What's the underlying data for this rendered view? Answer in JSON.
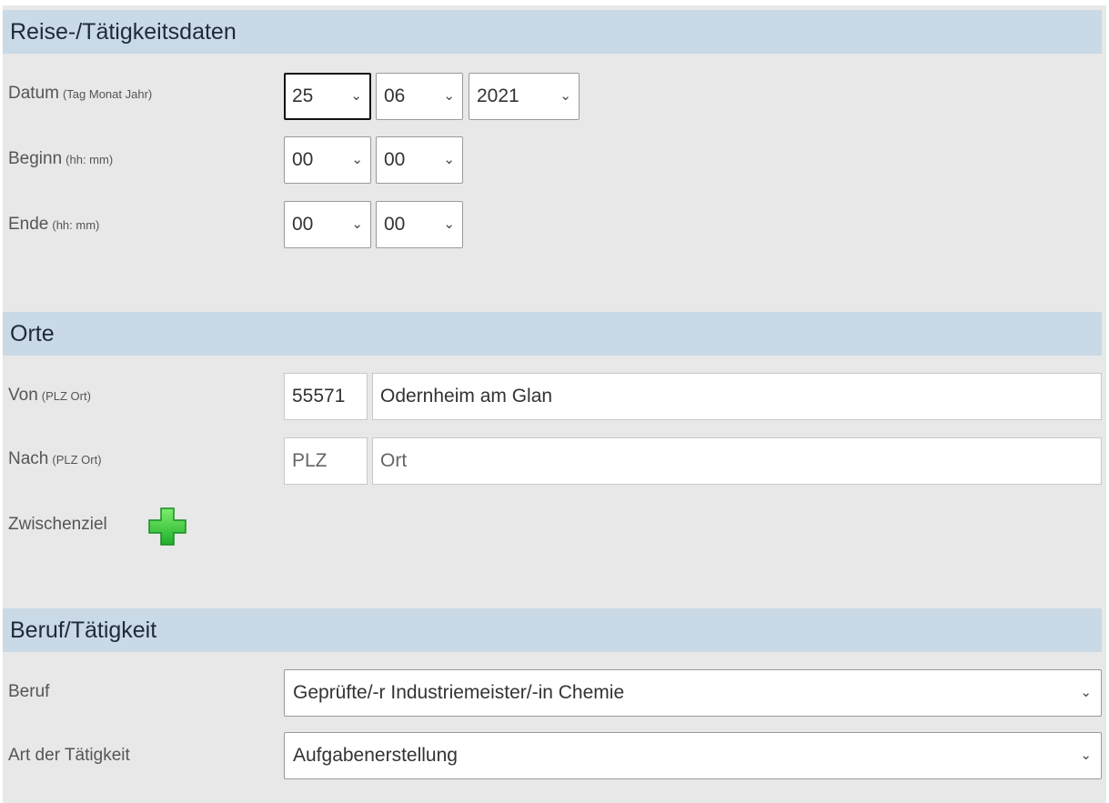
{
  "sections": {
    "trip": {
      "title": "Reise-/Tätigkeitsdaten",
      "datum": {
        "label": "Datum",
        "hint": "(Tag Monat Jahr)",
        "day": "25",
        "month": "06",
        "year": "2021"
      },
      "beginn": {
        "label": "Beginn",
        "hint": "(hh: mm)",
        "hour": "00",
        "minute": "00"
      },
      "ende": {
        "label": "Ende",
        "hint": "(hh: mm)",
        "hour": "00",
        "minute": "00"
      }
    },
    "orte": {
      "title": "Orte",
      "von": {
        "label": "Von",
        "hint": "(PLZ Ort)",
        "plz": "55571",
        "ort": "Odernheim am Glan"
      },
      "nach": {
        "label": "Nach",
        "hint": "(PLZ Ort)",
        "plz_placeholder": "PLZ",
        "ort_placeholder": "Ort"
      },
      "zwischenziel": {
        "label": "Zwischenziel",
        "add_icon": "plus-icon",
        "icon_color": "#2ecc40"
      }
    },
    "beruf": {
      "title": "Beruf/Tätigkeit",
      "beruf": {
        "label": "Beruf",
        "value": "Geprüfte/-r Industriemeister/-in Chemie"
      },
      "art": {
        "label": "Art der Tätigkeit",
        "value": "Aufgabenerstellung"
      }
    }
  },
  "colors": {
    "header_bg": "#c9d9e6",
    "panel_bg": "#e8e8e8",
    "plus_green": "#2ecc40"
  }
}
